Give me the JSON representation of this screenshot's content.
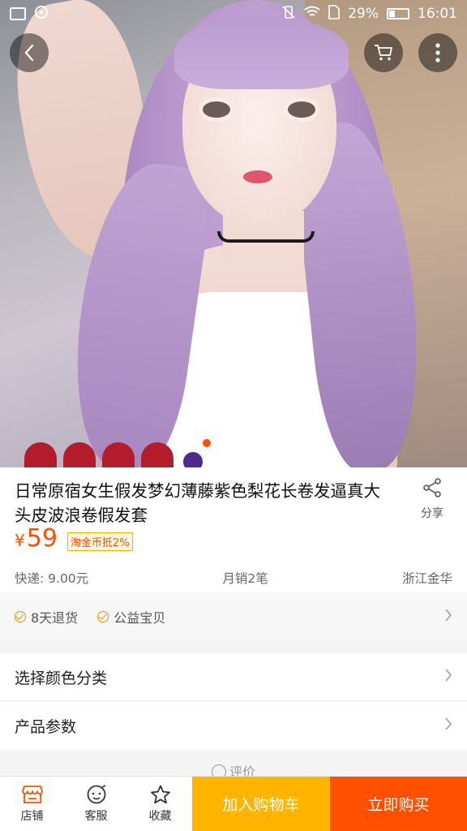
{
  "status_bar": {
    "battery_percent": "29%",
    "time": "16:01"
  },
  "nav": {
    "back_icon": "chevron-left-icon",
    "cart_icon": "cart-icon",
    "more_icon": "more-vertical-icon"
  },
  "gallery": {
    "page_count": 4,
    "active_index": 0
  },
  "product": {
    "title": "日常原宿女生假发梦幻薄藤紫色梨花长卷发逼真大头皮波浪卷假发套",
    "share_label": "分享",
    "currency": "¥",
    "price": "59",
    "coin_tag": "淘金币抵2%",
    "shipping": "快递: 9.00元",
    "monthly_sales": "月销2笔",
    "location": "浙江金华"
  },
  "services": {
    "items": [
      "8天退货",
      "公益宝贝"
    ]
  },
  "options": {
    "color_label": "选择颜色分类",
    "params_label": "产品参数"
  },
  "review_hint": "评价",
  "bottom_bar": {
    "shop_label": "店铺",
    "service_label": "客服",
    "favorite_label": "收藏",
    "add_cart_label": "加入购物车",
    "buy_now_label": "立即购买"
  },
  "colors": {
    "accent": "#ff5000",
    "cart_button": "#ffb400"
  }
}
